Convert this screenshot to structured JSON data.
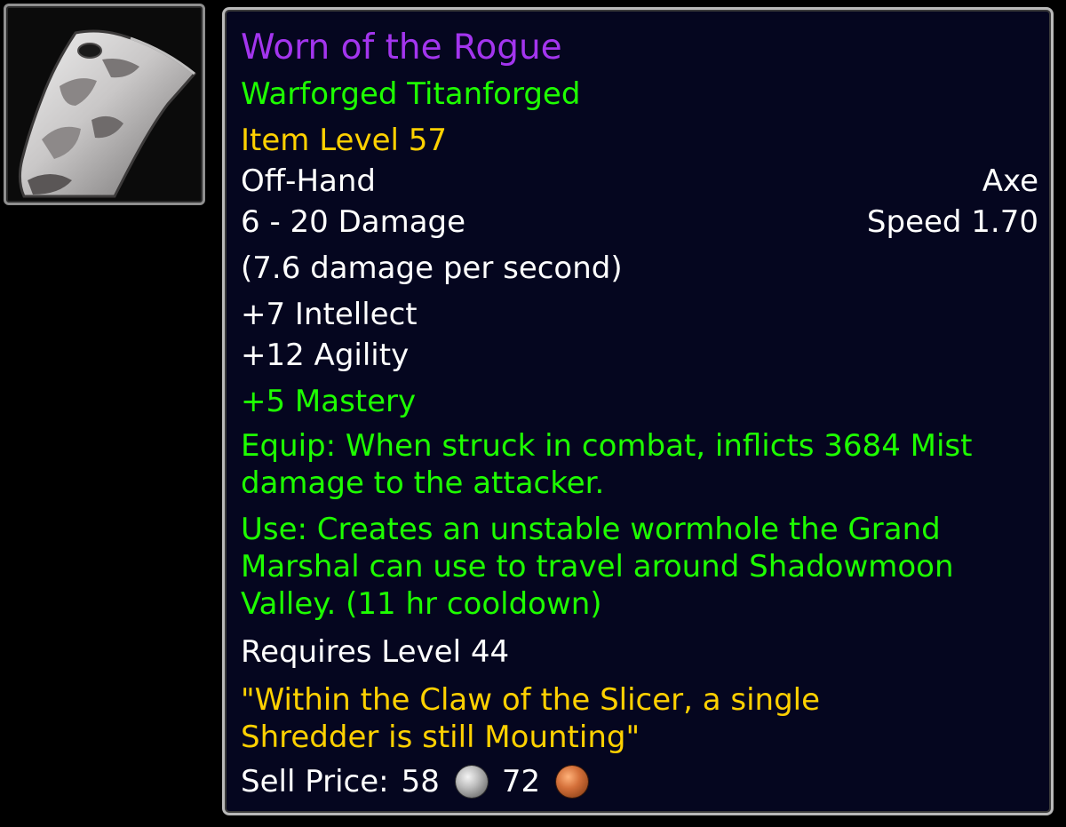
{
  "item": {
    "icon": "axe-blade-icon",
    "name": "Worn of the Rogue",
    "forge": "Warforged Titanforged",
    "item_level": "Item Level 57",
    "slot": "Off-Hand",
    "type": "Axe",
    "damage": "6 - 20 Damage",
    "speed": "Speed 1.70",
    "dps": "(7.6 damage per second)",
    "stats": [
      "+7 Intellect",
      "+12 Agility"
    ],
    "bonus_stat": "+5 Mastery",
    "equip": "Equip: When struck in combat, inflicts 3684 Mist damage to the attacker.",
    "use": "Use: Creates an unstable wormhole the Grand Marshal can use to travel around Shadowmoon Valley. (11 hr cooldown)",
    "requires": "Requires Level 44",
    "flavor": "\"Within the Claw of the Slicer, a single Shredder is still Mounting\"",
    "sell_label": "Sell Price:",
    "sell_silver": "58",
    "sell_copper": "72"
  },
  "colors": {
    "epic_name": "#a335ee",
    "green_text": "#1eff00",
    "gold_text": "#ffd100",
    "white_text": "#ffffff",
    "tooltip_bg": "#05061f"
  }
}
